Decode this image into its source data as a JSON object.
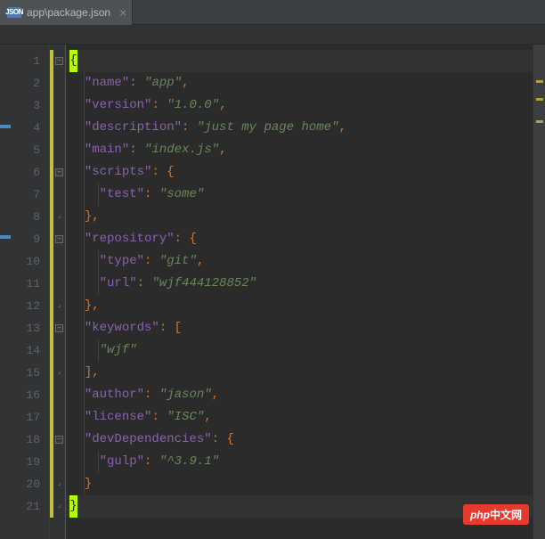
{
  "tab": {
    "icon_text": "JSON",
    "label": "app\\package.json",
    "close_glyph": "×"
  },
  "watermark": {
    "prefix": "php",
    "suffix": "中文网"
  },
  "lines": [
    {
      "n": 1,
      "fold": "minus",
      "hl": true,
      "mod": true,
      "indent": 0,
      "segs": [
        {
          "t": "caret",
          "v": "{"
        }
      ]
    },
    {
      "n": 2,
      "fold": "",
      "hl": false,
      "mod": true,
      "indent": 1,
      "segs": [
        {
          "t": "k",
          "v": "\"name\""
        },
        {
          "t": "p",
          "v": ": "
        },
        {
          "t": "s",
          "v": "\"app\""
        },
        {
          "t": "p",
          "v": ","
        }
      ]
    },
    {
      "n": 3,
      "fold": "",
      "hl": false,
      "mod": true,
      "indent": 1,
      "segs": [
        {
          "t": "k",
          "v": "\"version\""
        },
        {
          "t": "p",
          "v": ": "
        },
        {
          "t": "s",
          "v": "\"1.0.0\""
        },
        {
          "t": "p",
          "v": ","
        }
      ]
    },
    {
      "n": 4,
      "fold": "",
      "hl": false,
      "mod": true,
      "indent": 1,
      "segs": [
        {
          "t": "k",
          "v": "\"description\""
        },
        {
          "t": "p",
          "v": ": "
        },
        {
          "t": "s",
          "v": "\"just my page home\""
        },
        {
          "t": "p",
          "v": ","
        }
      ]
    },
    {
      "n": 5,
      "fold": "",
      "hl": false,
      "mod": true,
      "indent": 1,
      "segs": [
        {
          "t": "k",
          "v": "\"main\""
        },
        {
          "t": "p",
          "v": ": "
        },
        {
          "t": "s",
          "v": "\"index.js\""
        },
        {
          "t": "p",
          "v": ","
        }
      ]
    },
    {
      "n": 6,
      "fold": "minus",
      "hl": false,
      "mod": true,
      "indent": 1,
      "segs": [
        {
          "t": "k",
          "v": "\"scripts\""
        },
        {
          "t": "p",
          "v": ": "
        },
        {
          "t": "b",
          "v": "{"
        }
      ]
    },
    {
      "n": 7,
      "fold": "",
      "hl": false,
      "mod": true,
      "indent": 2,
      "segs": [
        {
          "t": "k",
          "v": "\"test\""
        },
        {
          "t": "p",
          "v": ": "
        },
        {
          "t": "s",
          "v": "\"some\""
        }
      ]
    },
    {
      "n": 8,
      "fold": "end",
      "hl": false,
      "mod": true,
      "indent": 1,
      "segs": [
        {
          "t": "b",
          "v": "}"
        },
        {
          "t": "p",
          "v": ","
        }
      ]
    },
    {
      "n": 9,
      "fold": "minus",
      "hl": false,
      "mod": true,
      "indent": 1,
      "segs": [
        {
          "t": "k",
          "v": "\"repository\""
        },
        {
          "t": "p",
          "v": ": "
        },
        {
          "t": "b",
          "v": "{"
        }
      ]
    },
    {
      "n": 10,
      "fold": "",
      "hl": false,
      "mod": true,
      "indent": 2,
      "segs": [
        {
          "t": "k",
          "v": "\"type\""
        },
        {
          "t": "p",
          "v": ": "
        },
        {
          "t": "s",
          "v": "\"git\""
        },
        {
          "t": "p",
          "v": ","
        }
      ]
    },
    {
      "n": 11,
      "fold": "",
      "hl": false,
      "mod": true,
      "indent": 2,
      "segs": [
        {
          "t": "k",
          "v": "\"url\""
        },
        {
          "t": "p",
          "v": ": "
        },
        {
          "t": "s",
          "v": "\"wjf444128852\""
        }
      ]
    },
    {
      "n": 12,
      "fold": "end",
      "hl": false,
      "mod": true,
      "indent": 1,
      "segs": [
        {
          "t": "b",
          "v": "}"
        },
        {
          "t": "p",
          "v": ","
        }
      ]
    },
    {
      "n": 13,
      "fold": "minus",
      "hl": false,
      "mod": true,
      "indent": 1,
      "segs": [
        {
          "t": "k",
          "v": "\"keywords\""
        },
        {
          "t": "p",
          "v": ": "
        },
        {
          "t": "b",
          "v": "["
        }
      ]
    },
    {
      "n": 14,
      "fold": "",
      "hl": false,
      "mod": true,
      "indent": 2,
      "segs": [
        {
          "t": "s",
          "v": "\"wjf\""
        }
      ]
    },
    {
      "n": 15,
      "fold": "end",
      "hl": false,
      "mod": true,
      "indent": 1,
      "segs": [
        {
          "t": "b",
          "v": "]"
        },
        {
          "t": "p",
          "v": ","
        }
      ]
    },
    {
      "n": 16,
      "fold": "",
      "hl": false,
      "mod": true,
      "indent": 1,
      "segs": [
        {
          "t": "k",
          "v": "\"author\""
        },
        {
          "t": "p",
          "v": ": "
        },
        {
          "t": "s",
          "v": "\"jason\""
        },
        {
          "t": "p",
          "v": ","
        }
      ]
    },
    {
      "n": 17,
      "fold": "",
      "hl": false,
      "mod": true,
      "indent": 1,
      "segs": [
        {
          "t": "k",
          "v": "\"license\""
        },
        {
          "t": "p",
          "v": ": "
        },
        {
          "t": "s",
          "v": "\"ISC\""
        },
        {
          "t": "p",
          "v": ","
        }
      ]
    },
    {
      "n": 18,
      "fold": "minus",
      "hl": false,
      "mod": true,
      "indent": 1,
      "segs": [
        {
          "t": "k",
          "v": "\"devDependencies\""
        },
        {
          "t": "p",
          "v": ": "
        },
        {
          "t": "b",
          "v": "{"
        }
      ]
    },
    {
      "n": 19,
      "fold": "",
      "hl": false,
      "mod": true,
      "indent": 2,
      "segs": [
        {
          "t": "k",
          "v": "\"gulp\""
        },
        {
          "t": "p",
          "v": ": "
        },
        {
          "t": "s",
          "v": "\"^3.9.1\""
        }
      ]
    },
    {
      "n": 20,
      "fold": "end",
      "hl": false,
      "mod": true,
      "indent": 1,
      "segs": [
        {
          "t": "b",
          "v": "}"
        }
      ]
    },
    {
      "n": 21,
      "fold": "end",
      "hl": true,
      "mod": true,
      "indent": 0,
      "segs": [
        {
          "t": "caret",
          "v": "}"
        }
      ]
    }
  ]
}
